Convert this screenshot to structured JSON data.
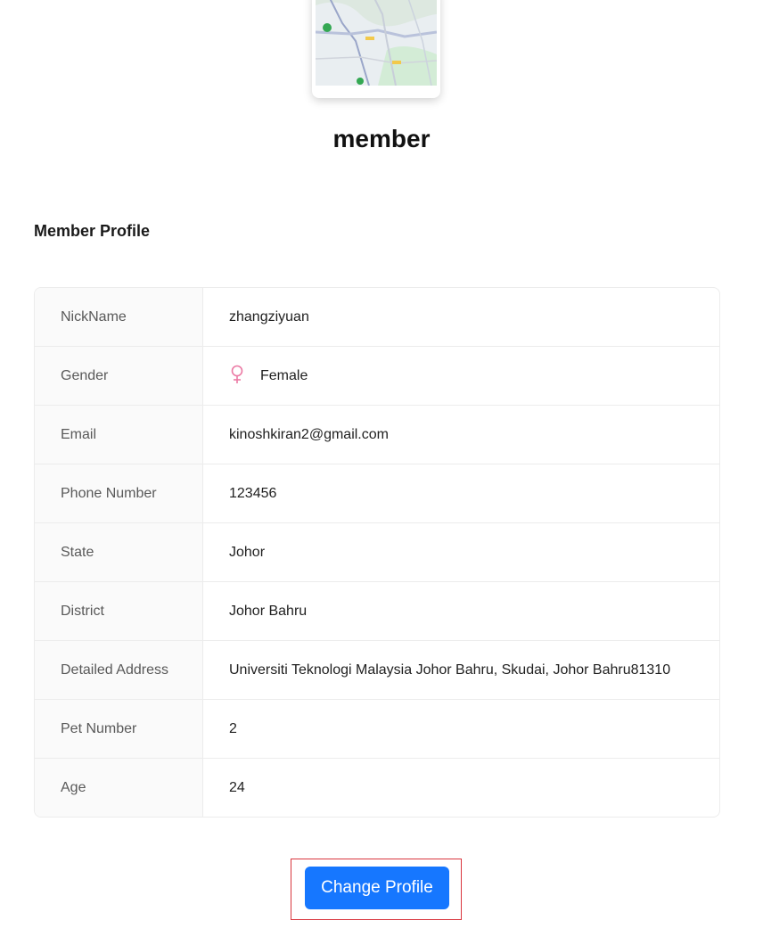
{
  "header": {
    "member_name": "member"
  },
  "section": {
    "title": "Member Profile"
  },
  "profile": {
    "rows": [
      {
        "label": "NickName",
        "value": "zhangziyuan"
      },
      {
        "label": "Gender",
        "value": "Female",
        "icon": "female-icon"
      },
      {
        "label": "Email",
        "value": "kinoshkiran2@gmail.com"
      },
      {
        "label": "Phone Number",
        "value": "123456"
      },
      {
        "label": "State",
        "value": "Johor"
      },
      {
        "label": "District",
        "value": "Johor Bahru"
      },
      {
        "label": "Detailed Address",
        "value": "Universiti Teknologi Malaysia Johor Bahru, Skudai, Johor Bahru81310"
      },
      {
        "label": "Pet Number",
        "value": "2"
      },
      {
        "label": "Age",
        "value": "24"
      }
    ]
  },
  "actions": {
    "change_profile_label": "Change Profile"
  },
  "colors": {
    "primary": "#1677ff",
    "female_icon": "#eb7aa4",
    "highlight": "#d9363e"
  }
}
